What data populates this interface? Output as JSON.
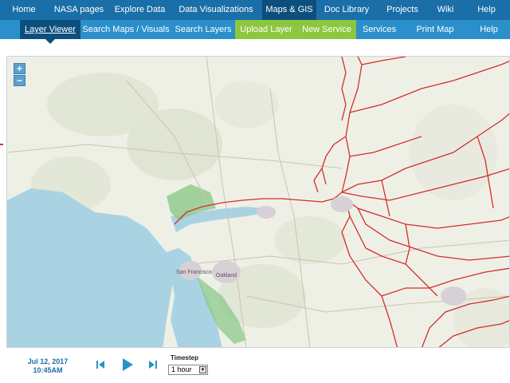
{
  "top_nav": {
    "items": [
      {
        "label": "Home"
      },
      {
        "label": "NASA pages"
      },
      {
        "label": "Explore Data"
      },
      {
        "label": "Data Visualizations"
      },
      {
        "label": "Maps & GIS"
      },
      {
        "label": "Doc Library"
      },
      {
        "label": "Projects"
      },
      {
        "label": "Wiki"
      },
      {
        "label": "Help"
      }
    ],
    "active_index": 4
  },
  "sub_nav": {
    "items": [
      {
        "label": "Layer Viewer"
      },
      {
        "label": "Search Maps / Visuals"
      },
      {
        "label": "Search Layers"
      },
      {
        "label": "Upload Layer"
      },
      {
        "label": "New Service"
      },
      {
        "label": "Services"
      },
      {
        "label": "Print Map"
      },
      {
        "label": "Help"
      }
    ],
    "active_index": 0
  },
  "map": {
    "zoom_in": "+",
    "zoom_out": "−",
    "place_labels": [
      "San Francisco",
      "Oakland"
    ]
  },
  "playback": {
    "date": "Jul 12, 2017",
    "time": "10:45AM",
    "timestep_label": "Timestep",
    "timestep_value": "1 hour"
  },
  "colors": {
    "top_nav": "#1a6fa8",
    "sub_nav": "#2b8fcc",
    "active_tab": "#0d4f7c",
    "green_button": "#8dc63f",
    "water": "#a9d3e3",
    "river_line": "#d62c2c"
  }
}
